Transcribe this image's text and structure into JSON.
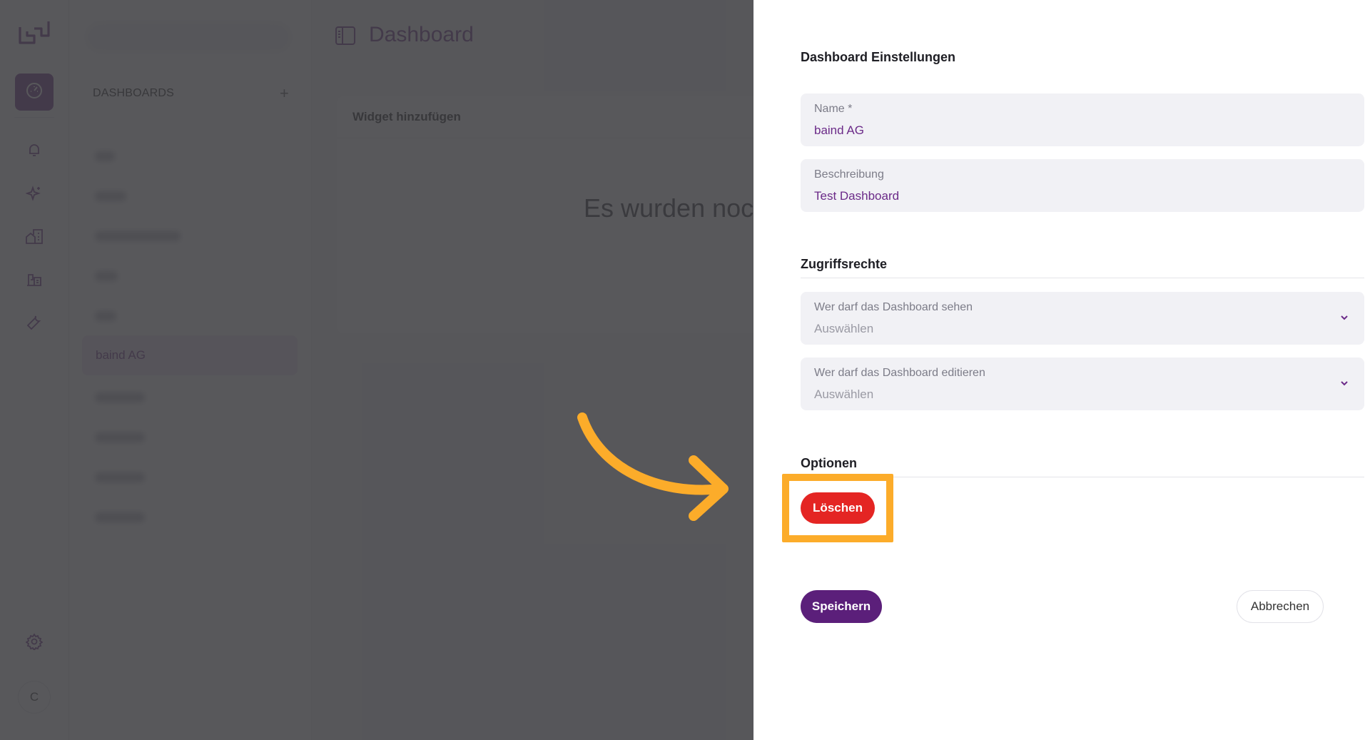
{
  "sidebar_nav": {
    "icons": [
      "logo-icon",
      "dashboard-icon",
      "bell-icon",
      "sparkle-icon",
      "buildings-icon",
      "blocks-icon",
      "wrench-icon",
      "gear-icon"
    ],
    "avatar_initial": "C"
  },
  "dashboards_panel": {
    "title": "DASHBOARDS",
    "add_label": "+",
    "selected_item": "baind AG"
  },
  "main": {
    "page_title": "Dashboard",
    "widget_card_title": "Widget hinzufügen",
    "empty_message": "Es wurden noc"
  },
  "drawer": {
    "title": "Dashboard Einstellungen",
    "name_field": {
      "label": "Name *",
      "value": "baind AG"
    },
    "description_field": {
      "label": "Beschreibung",
      "value": "Test Dashboard"
    },
    "access_title": "Zugriffsrechte",
    "view_select": {
      "label": "Wer darf das Dashboard sehen",
      "placeholder": "Auswählen"
    },
    "edit_select": {
      "label": "Wer darf das Dashboard editieren",
      "placeholder": "Auswählen"
    },
    "options_title": "Optionen",
    "delete_label": "Löschen",
    "save_label": "Speichern",
    "cancel_label": "Abbrechen"
  },
  "colors": {
    "brand": "#6b2a88",
    "danger": "#e42523",
    "highlight": "#fcac2a"
  }
}
